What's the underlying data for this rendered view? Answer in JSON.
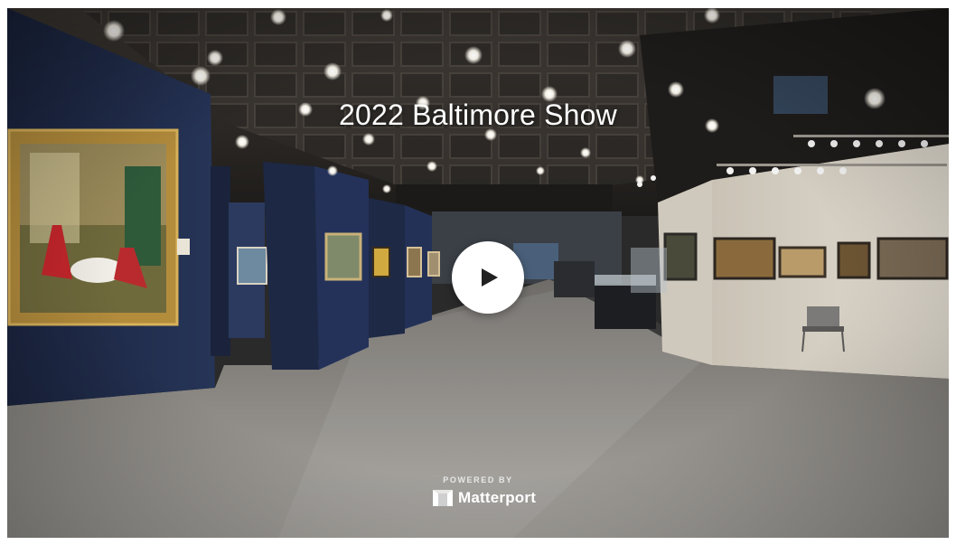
{
  "showcase": {
    "title": "2022 Baltimore Show",
    "play_icon": "play-icon",
    "powered_by": "POWERED BY",
    "brand_name": "Matterport",
    "brand_icon": "matterport-logo-icon"
  },
  "colors": {
    "wall_navy": "#1e2a44",
    "ceiling": "#3a3632",
    "floor": "#8e8a84",
    "booth_wall": "#d8d2c6",
    "gold_frame": "#b8903a",
    "play_bg": "#ffffff"
  }
}
